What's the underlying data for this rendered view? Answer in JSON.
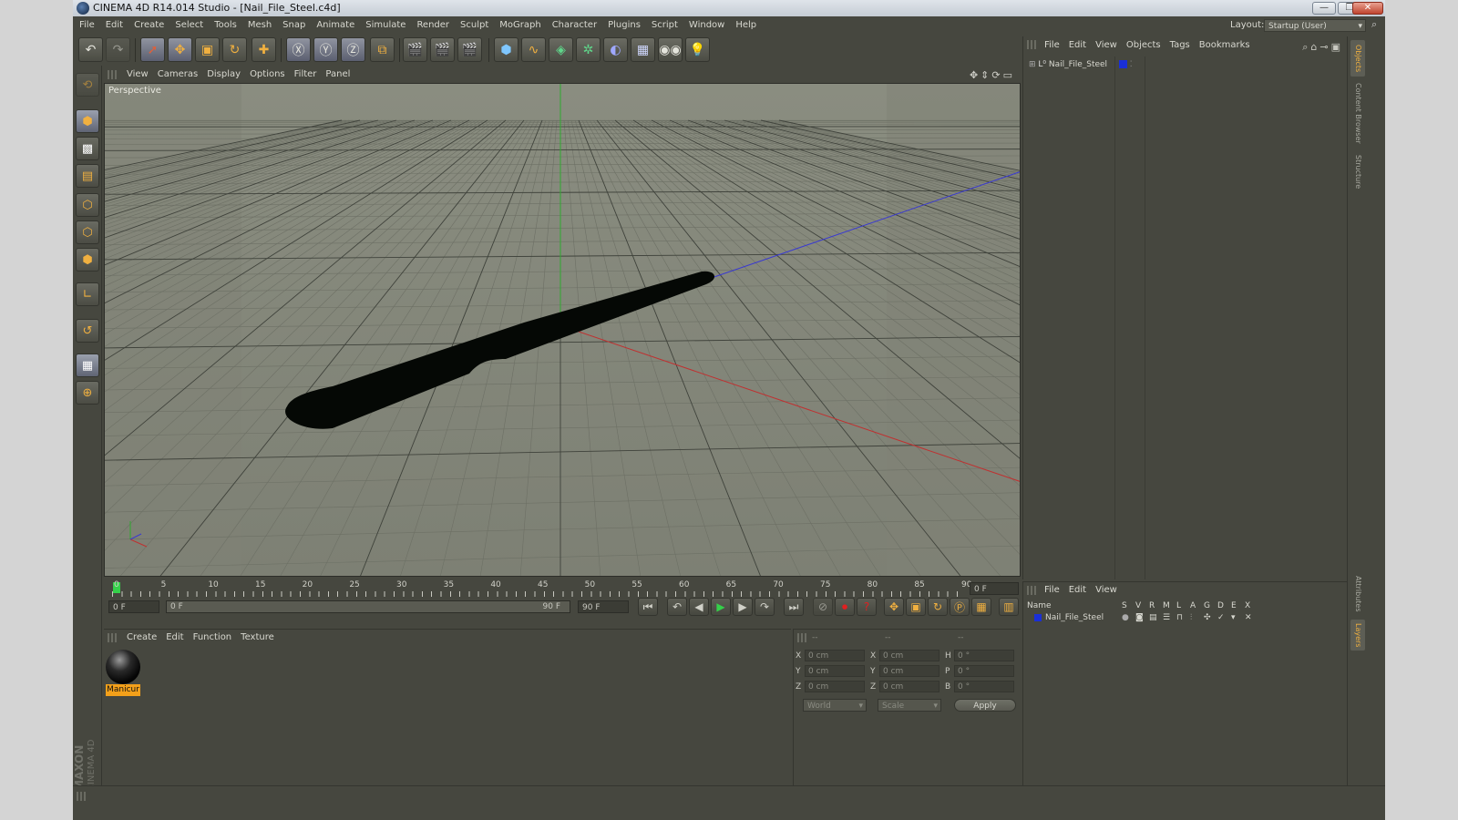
{
  "window": {
    "title": "CINEMA 4D R14.014 Studio - [Nail_File_Steel.c4d]",
    "min": "—",
    "max": "❐",
    "close": "✕"
  },
  "menubar": {
    "items": [
      "File",
      "Edit",
      "Create",
      "Select",
      "Tools",
      "Mesh",
      "Snap",
      "Animate",
      "Simulate",
      "Render",
      "Sculpt",
      "MoGraph",
      "Character",
      "Plugins",
      "Script",
      "Window",
      "Help"
    ],
    "layout_label": "Layout:",
    "layout_value": "Startup (User)"
  },
  "viewport": {
    "menu": [
      "View",
      "Cameras",
      "Display",
      "Options",
      "Filter",
      "Panel"
    ],
    "label": "Perspective"
  },
  "timeline": {
    "ticks": [
      "0",
      "5",
      "10",
      "15",
      "20",
      "25",
      "30",
      "35",
      "40",
      "45",
      "50",
      "55",
      "60",
      "65",
      "70",
      "75",
      "80",
      "85",
      "90"
    ],
    "current_frame": "0 F",
    "start_frame": "0 F",
    "range_start": "0 F",
    "range_end": "90 F",
    "end_frame": "90 F"
  },
  "material_manager": {
    "menu": [
      "Create",
      "Edit",
      "Function",
      "Texture"
    ],
    "material_name": "Manicur"
  },
  "coordinates": {
    "headers": [
      "--",
      "--",
      "--"
    ],
    "rows": [
      {
        "a": "X",
        "av": "0 cm",
        "b": "X",
        "bv": "0 cm",
        "c": "H",
        "cv": "0 °"
      },
      {
        "a": "Y",
        "av": "0 cm",
        "b": "Y",
        "bv": "0 cm",
        "c": "P",
        "cv": "0 °"
      },
      {
        "a": "Z",
        "av": "0 cm",
        "b": "Z",
        "bv": "0 cm",
        "c": "B",
        "cv": "0 °"
      }
    ],
    "world": "World",
    "scale": "Scale",
    "apply": "Apply"
  },
  "object_manager": {
    "menu": [
      "File",
      "Edit",
      "View",
      "Objects",
      "Tags",
      "Bookmarks"
    ],
    "object_name": "Nail_File_Steel"
  },
  "layer_manager": {
    "menu": [
      "File",
      "Edit",
      "View"
    ],
    "columns": [
      "Name",
      "S",
      "V",
      "R",
      "M",
      "L",
      "A",
      "G",
      "D",
      "E",
      "X"
    ],
    "layer_name": "Nail_File_Steel"
  },
  "side_tabs": [
    "Objects",
    "Content Browser",
    "Structure",
    "Attributes",
    "Layers"
  ],
  "logo": {
    "brand": "MAXON",
    "product": "CINEMA 4D"
  },
  "colors": {
    "panel_bg": "#46473f",
    "viewport_bg": "#888b7f",
    "accent_orange": "#f3a01a",
    "playhead_green": "#35d04a",
    "layer_blue": "#1a2fd8"
  }
}
